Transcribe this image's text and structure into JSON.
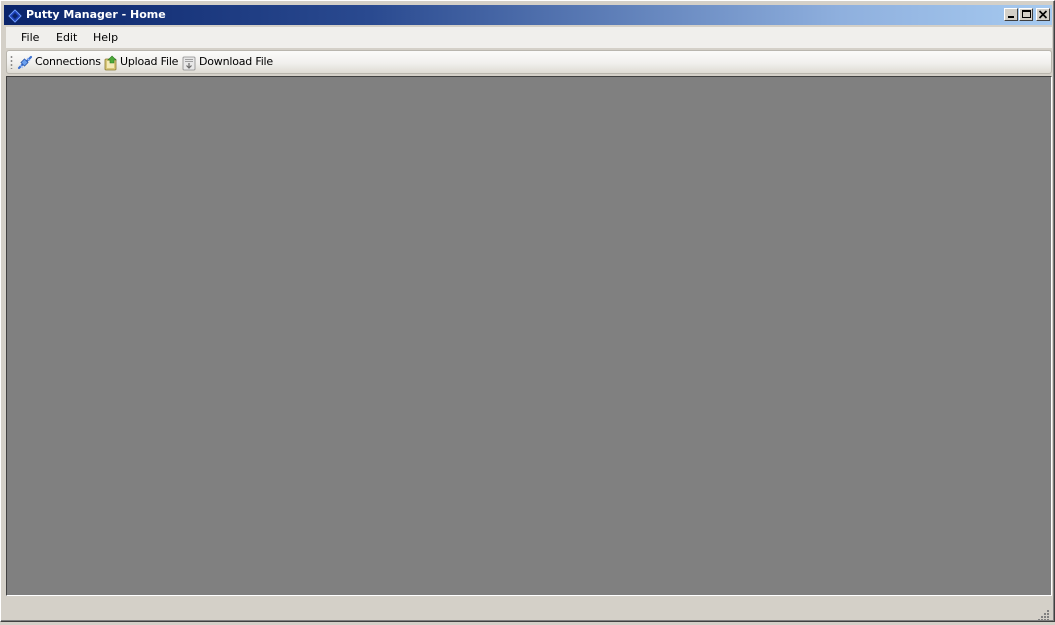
{
  "window": {
    "title": "Putty Manager - Home",
    "icon": "diamond-app-icon",
    "controls": {
      "minimize": "minimize-icon",
      "maximize": "maximize-icon",
      "close": "close-icon"
    },
    "title_gradient": [
      "#0a246a",
      "#a6caf0"
    ]
  },
  "menubar": {
    "items": [
      {
        "label": "File"
      },
      {
        "label": "Edit"
      },
      {
        "label": "Help"
      }
    ]
  },
  "toolbar": {
    "buttons": [
      {
        "label": "Connections",
        "icon": "connections-icon"
      },
      {
        "label": "Upload File",
        "icon": "upload-icon"
      },
      {
        "label": "Download File",
        "icon": "download-icon"
      }
    ]
  },
  "workspace": {
    "background": "#808080"
  },
  "statusbar": {
    "text": ""
  }
}
